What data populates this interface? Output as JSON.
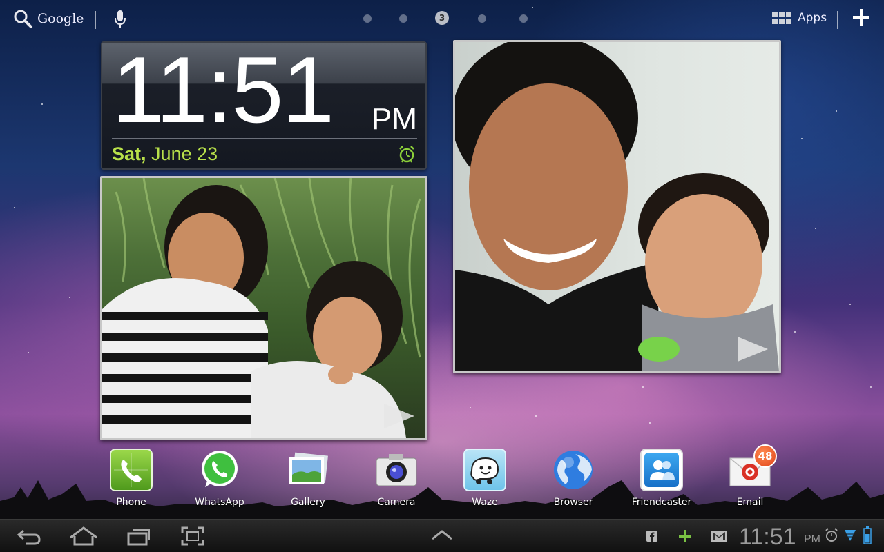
{
  "top_bar": {
    "search_label": "Google",
    "page_indicator": {
      "current": "3",
      "total": 5
    },
    "apps_label": "Apps"
  },
  "clock_widget": {
    "time": "11:51",
    "ampm": "PM",
    "day": "Sat,",
    "date": "June 23"
  },
  "dock": {
    "apps": [
      {
        "label": "Phone",
        "icon": "phone-icon"
      },
      {
        "label": "WhatsApp",
        "icon": "whatsapp-icon"
      },
      {
        "label": "Gallery",
        "icon": "gallery-icon"
      },
      {
        "label": "Camera",
        "icon": "camera-icon"
      },
      {
        "label": "Waze",
        "icon": "waze-icon"
      },
      {
        "label": "Browser",
        "icon": "browser-icon"
      },
      {
        "label": "Friendcaster",
        "icon": "friendcaster-icon"
      },
      {
        "label": "Email",
        "icon": "email-icon",
        "badge": "48"
      }
    ]
  },
  "status_bar": {
    "time": "11:51",
    "ampm": "PM"
  },
  "colors": {
    "clock_date": "#b8e04a",
    "badge": "#e0451a",
    "accent_green": "#7ac143"
  }
}
